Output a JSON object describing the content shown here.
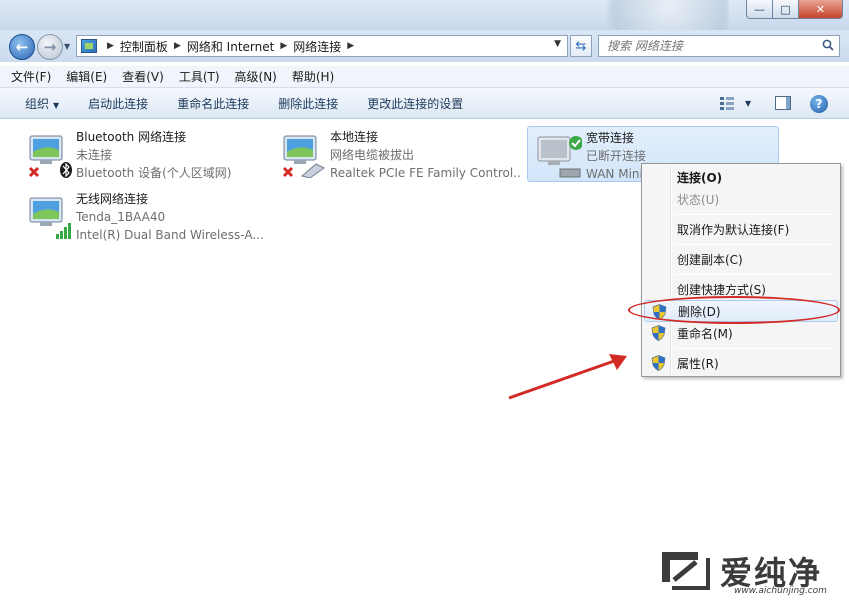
{
  "window": {
    "caption": {
      "minimize": "—",
      "maximize": "□",
      "close": "✕"
    }
  },
  "address": {
    "crumbs": [
      "控制面板",
      "网络和 Internet",
      "网络连接"
    ],
    "search_placeholder": "搜索 网络连接"
  },
  "menubar": {
    "items": [
      "文件(F)",
      "编辑(E)",
      "查看(V)",
      "工具(T)",
      "高级(N)",
      "帮助(H)"
    ]
  },
  "toolbar": {
    "organize": "组织",
    "enable": "启动此连接",
    "rename": "重命名此连接",
    "delete": "删除此连接",
    "change_settings": "更改此连接的设置",
    "help": "?"
  },
  "connections": [
    {
      "name": "Bluetooth 网络连接",
      "status": "未连接",
      "device": "Bluetooth 设备(个人区域网)"
    },
    {
      "name": "本地连接",
      "status": "网络电缆被拔出",
      "device": "Realtek PCIe FE Family Control..."
    },
    {
      "name": "宽带连接",
      "status": "已断开连接",
      "device": "WAN Mini"
    },
    {
      "name": "无线网络连接",
      "status": "Tenda_1BAA40",
      "device": "Intel(R) Dual Band Wireless-A..."
    }
  ],
  "context_menu": {
    "items": [
      {
        "label": "连接(O)"
      },
      {
        "label": "状态(U)"
      },
      {
        "label": "取消作为默认连接(F)"
      },
      {
        "label": "创建副本(C)"
      },
      {
        "label": "创建快捷方式(S)"
      },
      {
        "label": "删除(D)"
      },
      {
        "label": "重命名(M)"
      },
      {
        "label": "属性(R)"
      }
    ]
  },
  "watermark": {
    "text": "爱纯净",
    "url": "www.aichunjing.com"
  },
  "colors": {
    "annotation": "#d22b25",
    "selection": "#d2e5fa",
    "link": "#1e3a5c"
  }
}
